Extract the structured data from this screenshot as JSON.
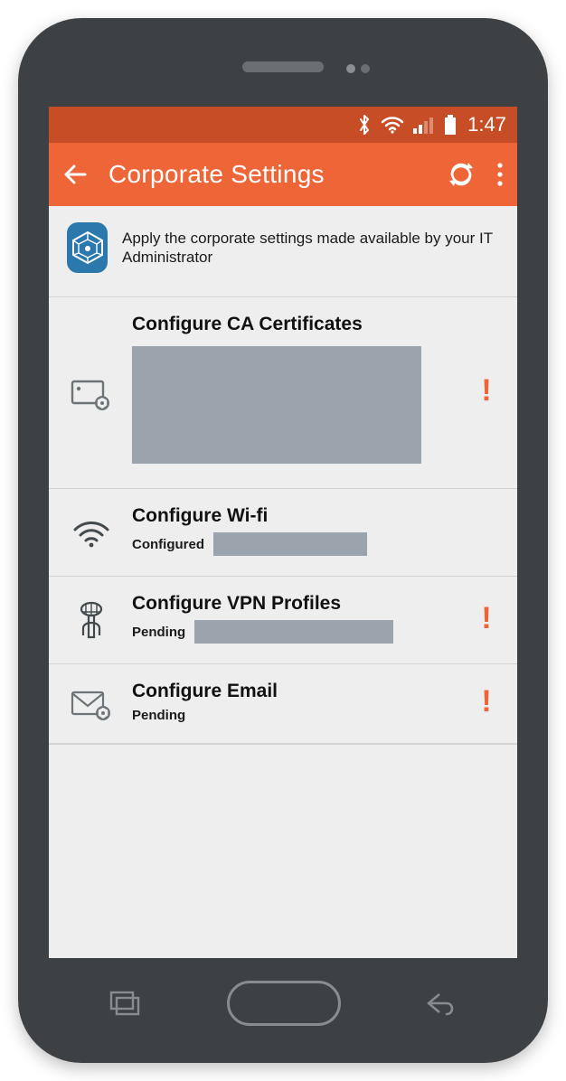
{
  "statusbar": {
    "time": "1:47"
  },
  "appbar": {
    "title": "Corporate Settings"
  },
  "banner": {
    "text": "Apply the corporate settings made available by your IT Administrator"
  },
  "rows": {
    "ca": {
      "title": "Configure CA Certificates",
      "alert": "!"
    },
    "wifi": {
      "title": "Configure Wi-fi",
      "status": "Configured"
    },
    "vpn": {
      "title": "Configure VPN Profiles",
      "status": "Pending",
      "alert": "!"
    },
    "email": {
      "title": "Configure Email",
      "status": "Pending",
      "alert": "!"
    }
  },
  "colors": {
    "accent": "#ee6638",
    "statusbar": "#c74d26"
  }
}
